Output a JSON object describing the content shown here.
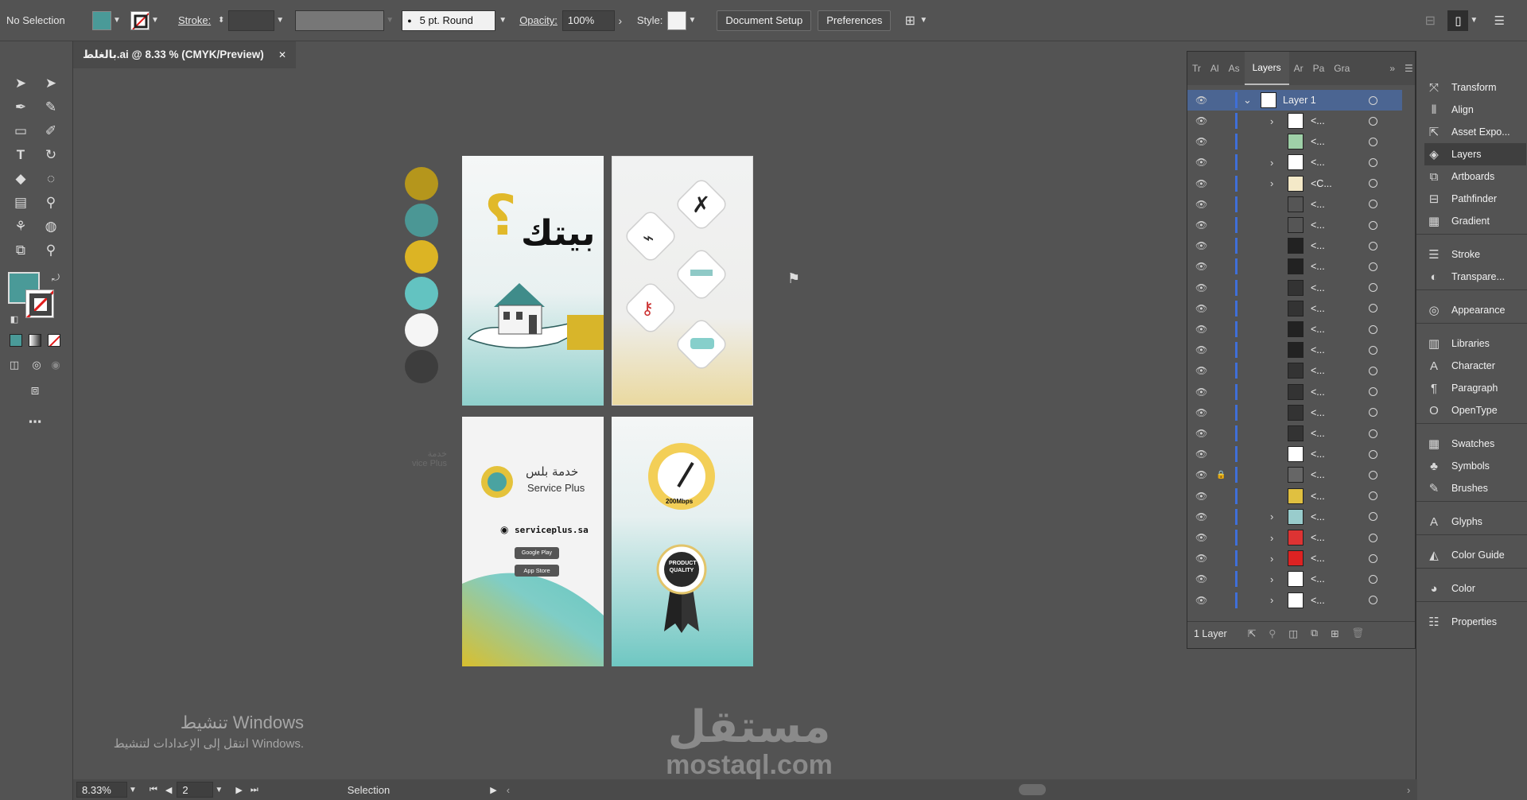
{
  "control_bar": {
    "selection": "No Selection",
    "stroke_label": "Stroke:",
    "brush": "5 pt. Round",
    "opacity_label": "Opacity:",
    "opacity": "100%",
    "style_label": "Style:",
    "document_setup": "Document Setup",
    "preferences": "Preferences",
    "fill_color": "#4a9a98"
  },
  "document_tab": {
    "title": "بالغلط.ai @ 8.33 % (CMYK/Preview)",
    "close": "✕"
  },
  "swatches": [
    "#b5961c",
    "#4b9795",
    "#dcb424",
    "#63c3c1",
    "#f5f5f5",
    "#3d3d3d"
  ],
  "artboard1": {
    "headline": "بيتك",
    "question": "؟"
  },
  "artboard3": {
    "brand_ar": "خدمة بلس",
    "brand_en": "Service Plus",
    "website": "serviceplus.sa",
    "google_play": "Google Play",
    "app_store": "App Store"
  },
  "artboard4": {
    "speed": "200Mbps",
    "badge": "PRODUCT QUALITY"
  },
  "faded_label": {
    "ar": "خدمة",
    "en": "vice Plus"
  },
  "layers_panel": {
    "tabs": [
      "Tr",
      "Al",
      "As",
      "Layers",
      "Ar",
      "Pa",
      "Gra"
    ],
    "active_tab": "Layers",
    "layer_name": "Layer 1",
    "rows": [
      "<...",
      "<...",
      "<...",
      "<C...",
      "<...",
      "<...",
      "<...",
      "<...",
      "<...",
      "<...",
      "<...",
      "<...",
      "<...",
      "<...",
      "<...",
      "<...",
      "<...",
      "<...",
      "<...",
      "<...",
      "<...",
      "<...",
      "<...",
      "<..."
    ],
    "footer": "1 Layer"
  },
  "right_panel": {
    "items": [
      "Transform",
      "Align",
      "Asset Expo...",
      "Layers",
      "Artboards",
      "Pathfinder",
      "Gradient",
      "Stroke",
      "Transpare...",
      "Appearance",
      "Libraries",
      "Character",
      "Paragraph",
      "OpenType",
      "Swatches",
      "Symbols",
      "Brushes",
      "Glyphs",
      "Color Guide",
      "Color",
      "Properties"
    ]
  },
  "status_bar": {
    "zoom": "8.33%",
    "artboard": "2",
    "tool": "Selection"
  },
  "windows_activation": {
    "title": "تنشيط Windows",
    "subtitle": "انتقل إلى الإعدادات لتنشيط Windows."
  },
  "watermark": {
    "ar": "مستقل",
    "en": "mostaql.com"
  }
}
